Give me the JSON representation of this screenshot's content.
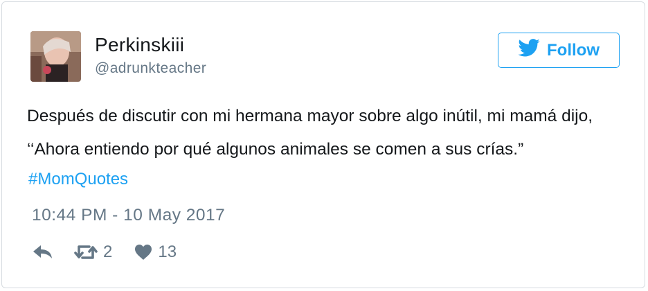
{
  "user": {
    "name": "Perkinskiii",
    "handle": "@adrunkteacher"
  },
  "follow_button": {
    "label": "Follow"
  },
  "tweet": {
    "line1": "Después de discutir con mi hermana mayor sobre algo inútil, mi mamá dijo,",
    "line2": "‘‘Ahora entiendo por qué algunos animales se comen a sus crías.”",
    "hashtag": "#MomQuotes",
    "timestamp": "10:44 PM - 10 May 2017"
  },
  "stats": {
    "retweets": "2",
    "likes": "13"
  },
  "colors": {
    "accent": "#1da1f2",
    "text": "#14171a",
    "muted": "#657786"
  },
  "icons": [
    "twitter-bird-icon",
    "reply-icon",
    "retweet-icon",
    "heart-icon"
  ]
}
